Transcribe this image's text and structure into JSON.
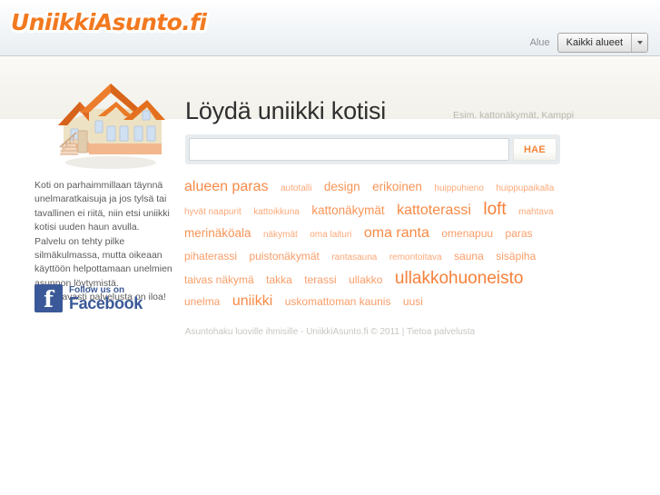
{
  "header": {
    "logo_text": "UniikkiAsunto.fi",
    "area_label": "Alue",
    "area_selected": "Kaikki alueet",
    "area_options": [
      "Kaikki alueet"
    ]
  },
  "hero": {
    "title": "Löydä uniikki kotisi",
    "hint": "Esim. kattonäkymät, Kamppi"
  },
  "search": {
    "value": "",
    "placeholder": "",
    "submit_label": "HAE"
  },
  "tags": [
    {
      "label": "alueen paras",
      "size": "s5"
    },
    {
      "label": "autotalli",
      "size": "s2"
    },
    {
      "label": "design",
      "size": "s4"
    },
    {
      "label": "erikoinen",
      "size": "s4"
    },
    {
      "label": "huippuhieno",
      "size": "s2"
    },
    {
      "label": "huippupaikalla",
      "size": "s2"
    },
    {
      "label": "hyvät naapurit",
      "size": "s2"
    },
    {
      "label": "kattoikkuna",
      "size": "s2"
    },
    {
      "label": "kattonäkymät",
      "size": "s4"
    },
    {
      "label": "kattoterassi",
      "size": "s5"
    },
    {
      "label": "loft",
      "size": "s6"
    },
    {
      "label": "mahtava",
      "size": "s2"
    },
    {
      "label": "merinäköala",
      "size": "s4"
    },
    {
      "label": "näkymät",
      "size": "s2"
    },
    {
      "label": "oma laituri",
      "size": "s2"
    },
    {
      "label": "oma ranta",
      "size": "s5"
    },
    {
      "label": "omenapuu",
      "size": "s3"
    },
    {
      "label": "paras",
      "size": "s3"
    },
    {
      "label": "pihaterassi",
      "size": "s3"
    },
    {
      "label": "puistonäkymät",
      "size": "s3"
    },
    {
      "label": "rantasauna",
      "size": "s2"
    },
    {
      "label": "remontoitava",
      "size": "s2"
    },
    {
      "label": "sauna",
      "size": "s3"
    },
    {
      "label": "sisäpiha",
      "size": "s3"
    },
    {
      "label": "taivas näkymä",
      "size": "s3"
    },
    {
      "label": "takka",
      "size": "s3"
    },
    {
      "label": "terassi",
      "size": "s3"
    },
    {
      "label": "ullakko",
      "size": "s3"
    },
    {
      "label": "ullakkohuoneisto",
      "size": "s6"
    },
    {
      "label": "unelma",
      "size": "s3"
    },
    {
      "label": "uniikki",
      "size": "s5"
    },
    {
      "label": "uskomattoman kaunis",
      "size": "s3"
    },
    {
      "label": "uusi",
      "size": "s3"
    }
  ],
  "sidebar": {
    "intro": "Koti on parhaimmillaan täynnä unelmaratkaisuja ja jos tylsä tai tavallinen ei riitä, niin etsi uniikki kotisi uuden haun avulla. Palvelu on tehty pilke silmäkulmassa, mutta oikeaan käyttöön helpottamaan unelmien asunnon löytymistä. Toivottavasti palvelusta on iloa!",
    "facebook_line1": "Follow us on",
    "facebook_line2": "Facebook"
  },
  "footer": {
    "text": "Asuntohaku luoville ihmisille - UniikkiAsunto.fi © 2011 | Tietoa palvelusta"
  },
  "colors": {
    "brand_orange": "#f2791f",
    "tag_orange": "#f88a46",
    "facebook_blue": "#3b5998",
    "header_band": "#e9eef2",
    "cream_band": "#f5f4ef"
  }
}
